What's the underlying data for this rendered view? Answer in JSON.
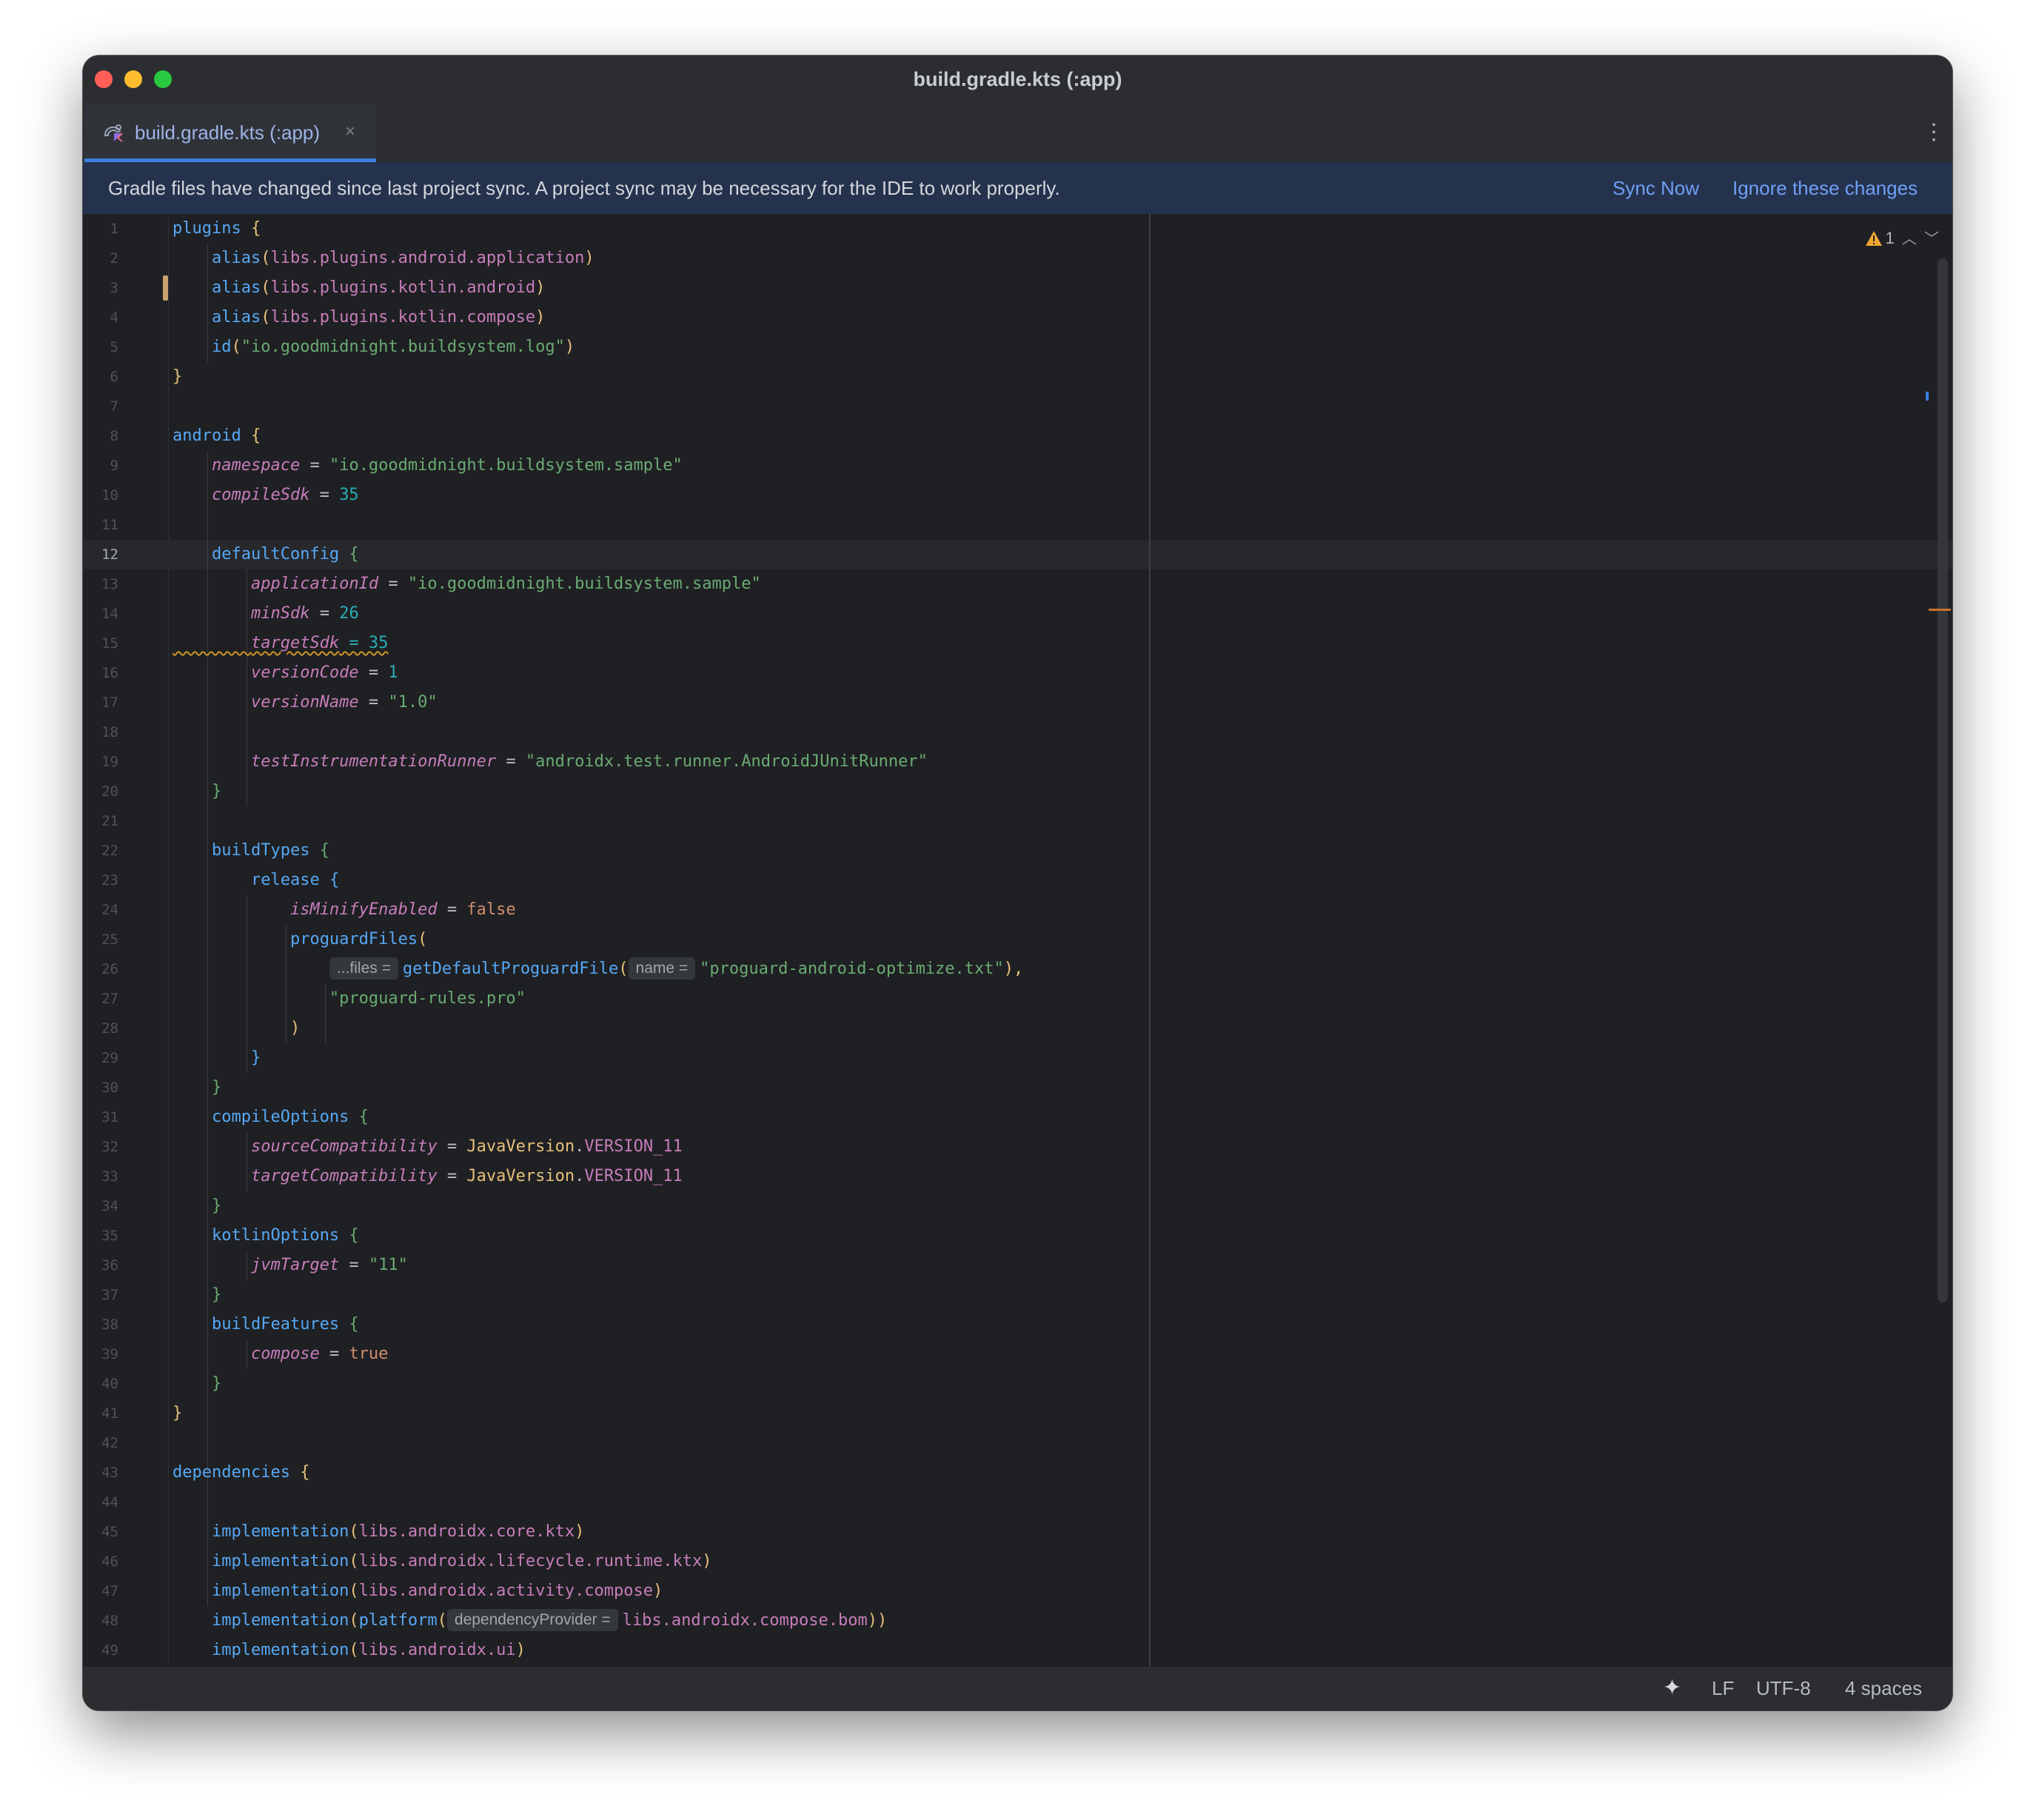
{
  "window": {
    "title": "build.gradle.kts (:app)"
  },
  "tab": {
    "label": "build.gradle.kts (:app)",
    "close_glyph": "×",
    "icon": "gradle-kotlin-file-icon"
  },
  "toolbar": {
    "more_glyph": "⋮"
  },
  "banner": {
    "message": "Gradle files have changed since last project sync. A project sync may be necessary for the IDE to work properly.",
    "sync_now": "Sync Now",
    "ignore": "Ignore these changes"
  },
  "inspections": {
    "warning_count": "1",
    "up_glyph": "︿",
    "down_glyph": "﹀"
  },
  "status": {
    "ai_glyph": "✦",
    "line_separator": "LF",
    "encoding": "UTF-8",
    "indent": "4 spaces"
  },
  "editor": {
    "current_line": 12,
    "lines": [
      {
        "n": "1"
      },
      {
        "n": "2"
      },
      {
        "n": "3"
      },
      {
        "n": "4"
      },
      {
        "n": "5"
      },
      {
        "n": "6"
      },
      {
        "n": "7"
      },
      {
        "n": "8"
      },
      {
        "n": "9"
      },
      {
        "n": "10"
      },
      {
        "n": "11"
      },
      {
        "n": "12"
      },
      {
        "n": "13"
      },
      {
        "n": "14"
      },
      {
        "n": "15"
      },
      {
        "n": "16"
      },
      {
        "n": "17"
      },
      {
        "n": "18"
      },
      {
        "n": "19"
      },
      {
        "n": "20"
      },
      {
        "n": "21"
      },
      {
        "n": "22"
      },
      {
        "n": "23"
      },
      {
        "n": "24"
      },
      {
        "n": "25"
      },
      {
        "n": "26"
      },
      {
        "n": "27"
      },
      {
        "n": "28"
      },
      {
        "n": "29"
      },
      {
        "n": "30"
      },
      {
        "n": "31"
      },
      {
        "n": "32"
      },
      {
        "n": "33"
      },
      {
        "n": "34"
      },
      {
        "n": "35"
      },
      {
        "n": "36"
      },
      {
        "n": "37"
      },
      {
        "n": "38"
      },
      {
        "n": "39"
      },
      {
        "n": "40"
      },
      {
        "n": "41"
      },
      {
        "n": "42"
      },
      {
        "n": "43"
      },
      {
        "n": "44"
      },
      {
        "n": "45"
      },
      {
        "n": "46"
      },
      {
        "n": "47"
      },
      {
        "n": "48"
      },
      {
        "n": "49"
      }
    ],
    "tokens": {
      "plugins": "plugins",
      "brace_open": "{",
      "brace_close": "}",
      "paren_open": "(",
      "paren_close": ")",
      "alias": "alias",
      "libs_plugins_android_application": "libs.plugins.android.application",
      "libs_plugins_kotlin_android": "libs.plugins.kotlin.android",
      "libs_plugins_kotlin_compose": "libs.plugins.kotlin.compose",
      "id": "id",
      "id_value": "\"io.goodmidnight.buildsystem.log\"",
      "android": "android",
      "namespace": "namespace",
      "eq": " = ",
      "namespace_value": "\"io.goodmidnight.buildsystem.sample\"",
      "compileSdk": "compileSdk",
      "compileSdk_value": "35",
      "defaultConfig": "defaultConfig",
      "applicationId": "applicationId",
      "applicationId_value": "\"io.goodmidnight.buildsystem.sample\"",
      "minSdk": "minSdk",
      "minSdk_value": "26",
      "targetSdk": "targetSdk",
      "targetSdk_eq_value": " = 35",
      "versionCode": "versionCode",
      "versionCode_value": "1",
      "versionName": "versionName",
      "versionName_value": "\"1.0\"",
      "testRunner": "testInstrumentationRunner",
      "testRunner_value": "\"androidx.test.runner.AndroidJUnitRunner\"",
      "buildTypes": "buildTypes",
      "release": "release",
      "isMinifyEnabled": "isMinifyEnabled",
      "false": "false",
      "proguardFiles": "proguardFiles",
      "hint_files": "...files =",
      "getDefaultProguardFile": "getDefaultProguardFile",
      "hint_name": "name =",
      "proguard_optimize": "\"proguard-android-optimize.txt\"",
      "comma_close": "),",
      "proguard_rules": "\"proguard-rules.pro\"",
      "compileOptions": "compileOptions",
      "sourceCompatibility": "sourceCompatibility",
      "targetCompatibility": "targetCompatibility",
      "JavaVersion": "JavaVersion",
      "dot": ".",
      "VERSION_11": "VERSION_11",
      "kotlinOptions": "kotlinOptions",
      "jvmTarget": "jvmTarget",
      "jvmTarget_value": "\"11\"",
      "buildFeatures": "buildFeatures",
      "compose": "compose",
      "true": "true",
      "dependencies": "dependencies",
      "implementation": "implementation",
      "libs_core_ktx": "libs.androidx.core.ktx",
      "libs_lifecycle": "libs.androidx.lifecycle.runtime.ktx",
      "libs_activity_compose": "libs.androidx.activity.compose",
      "platform": "platform",
      "hint_dependencyProvider": "dependencyProvider =",
      "libs_compose_bom": "libs.androidx.compose.bom",
      "double_close": "))",
      "libs_ui": "libs.androidx.ui"
    }
  }
}
